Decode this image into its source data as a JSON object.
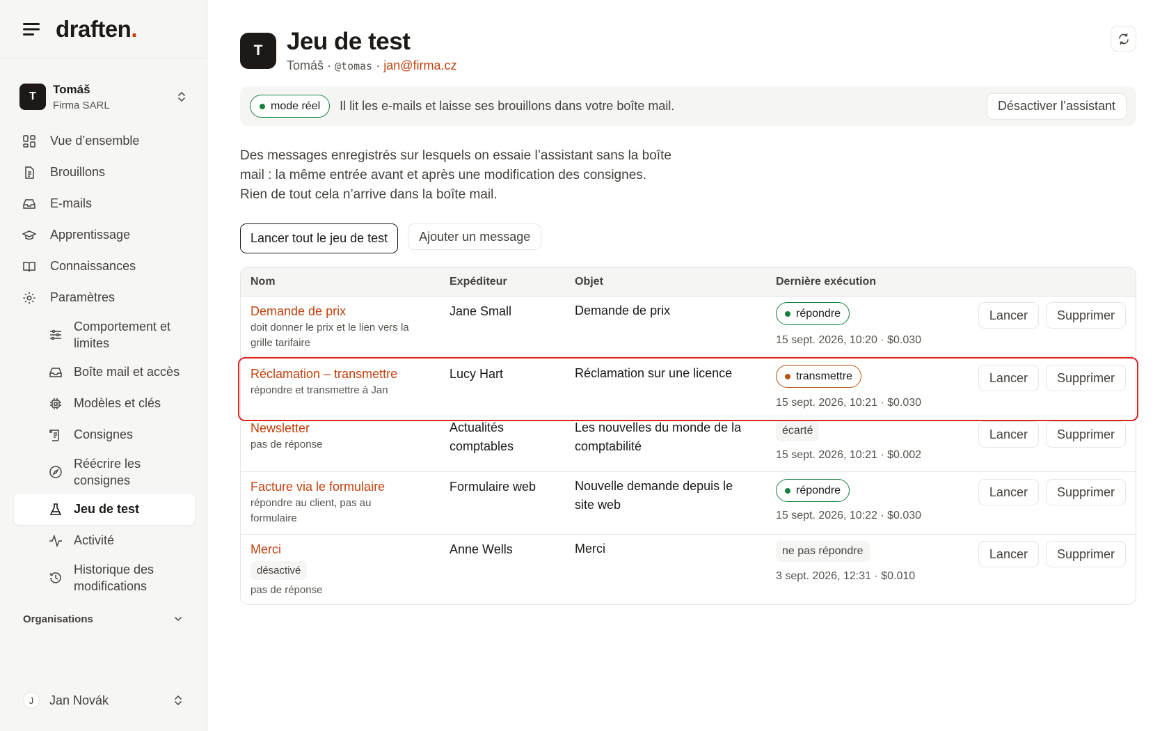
{
  "brand": {
    "name": "draften",
    "dot": "."
  },
  "workspace": {
    "avatar": "T",
    "name": "Tomáš",
    "company": "Firma SARL"
  },
  "nav": {
    "overview": "Vue d’ensemble",
    "drafts": "Brouillons",
    "emails": "E-mails",
    "learning": "Apprentissage",
    "knowledge": "Connaissances",
    "settings": "Paramètres",
    "behavior": "Comportement et limites",
    "mailbox": "Boîte mail et accès",
    "models": "Modèles et clés",
    "instructions": "Consignes",
    "rewrite": "Réécrire les consignes",
    "testset": "Jeu de test",
    "activity": "Activité",
    "history": "Historique des modifications"
  },
  "orgs_label": "Organisations",
  "user": {
    "avatar": "J",
    "name": "Jan Novák"
  },
  "page": {
    "avatar": "T",
    "title": "Jeu de test",
    "owner": "Tomáš",
    "sep1": " · ",
    "handle": "@tomas",
    "sep2": " · ",
    "email": "jan@firma.cz"
  },
  "banner": {
    "mode": "mode réel",
    "message": "Il lit les e-mails et laisse ses brouillons dans votre boîte mail.",
    "deactivate": "Désactiver l’assistant",
    "mode_color": "#15803d"
  },
  "description": "Des messages enregistrés sur lesquels on essaie l’assistant sans la boîte mail : la même entrée avant et après une modification des consignes. Rien de tout cela n’arrive dans la boîte mail.",
  "actions": {
    "run_all": "Lancer tout le jeu de test",
    "add": "Ajouter un message"
  },
  "table": {
    "headers": {
      "name": "Nom",
      "sender": "Expéditeur",
      "subject": "Objet",
      "last_run": "Dernière exécution"
    },
    "run_label": "Lancer",
    "delete_label": "Supprimer",
    "rows": [
      {
        "name": "Demande de prix",
        "desc": "doit donner le prix et le lien vers la grille tarifaire",
        "sender": "Jane Small",
        "subject": "Demande de prix",
        "status": "répondre",
        "meta": "15 sept. 2026, 10:20 · $0.030"
      },
      {
        "name": "Réclamation – transmettre",
        "desc": "répondre et transmettre à Jan",
        "sender": "Lucy Hart",
        "subject": "Réclamation sur une licence",
        "status": "transmettre",
        "meta": "15 sept. 2026, 10:21 · $0.030"
      },
      {
        "name": "Newsletter",
        "desc": "pas de réponse",
        "sender": "Actualités comptables",
        "subject": "Les nouvelles du monde de la comptabilité",
        "status": "écarté",
        "meta": "15 sept. 2026, 10:21 · $0.002"
      },
      {
        "name": "Facture via le formulaire",
        "desc": "répondre au client, pas au formulaire",
        "sender": "Formulaire web",
        "subject": "Nouvelle demande depuis le site web",
        "status": "répondre",
        "meta": "15 sept. 2026, 10:22 · $0.030"
      },
      {
        "name": "Merci",
        "tag": "désactivé",
        "desc": "pas de réponse",
        "sender": "Anne Wells",
        "subject": "Merci",
        "status": "ne pas répondre",
        "meta": "3 sept. 2026, 12:31 · $0.010"
      }
    ]
  },
  "colors": {
    "accent": "#c2410c",
    "green": "#15803d",
    "amber": "#b45309",
    "highlight": "#dc2626"
  }
}
